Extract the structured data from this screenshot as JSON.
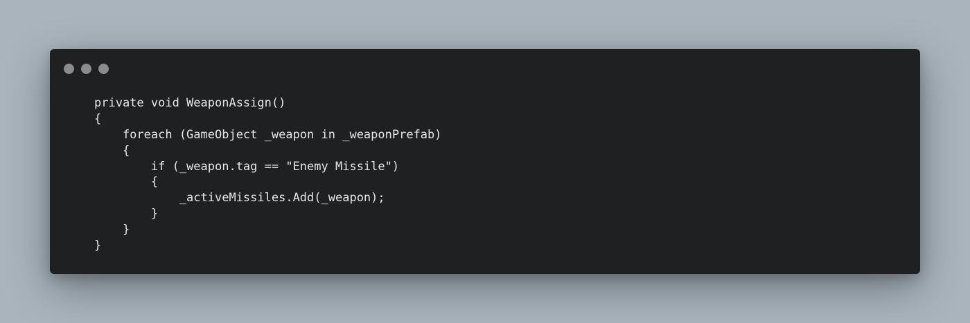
{
  "window": {
    "dots": [
      "close",
      "minimize",
      "maximize"
    ],
    "dot_color": "#8a8c8e",
    "background": "#1e2021",
    "page_background": "#a9b4bd"
  },
  "code": {
    "language": "csharp",
    "lines": [
      "private void WeaponAssign()",
      "{",
      "    foreach (GameObject _weapon in _weaponPrefab)",
      "    {",
      "        if (_weapon.tag == \"Enemy Missile\")",
      "        {",
      "            _activeMissiles.Add(_weapon);",
      "        }",
      "    }",
      "}"
    ]
  }
}
